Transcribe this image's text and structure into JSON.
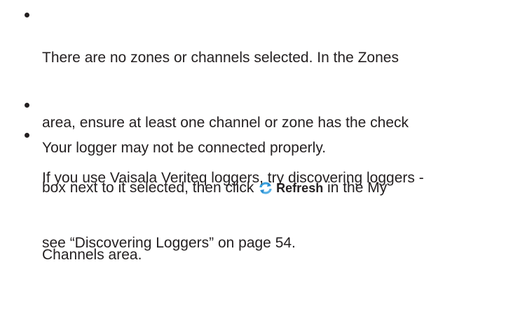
{
  "items": [
    {
      "line1": "There are no zones or channels selected. In the Zones",
      "line2": "area, ensure at least one channel or zone has the check",
      "line3_before": "box next to it selected, then click ",
      "refresh_label": "Refresh",
      "line3_after": " in the My",
      "line4": "Channels area."
    },
    {
      "line1": "Your logger may not be connected properly."
    },
    {
      "line1": "If you use Vaisala Veriteq loggers, try discovering loggers -",
      "line2": "see “Discovering Loggers” on page 54."
    }
  ],
  "icons": {
    "refresh": "refresh-icon"
  }
}
